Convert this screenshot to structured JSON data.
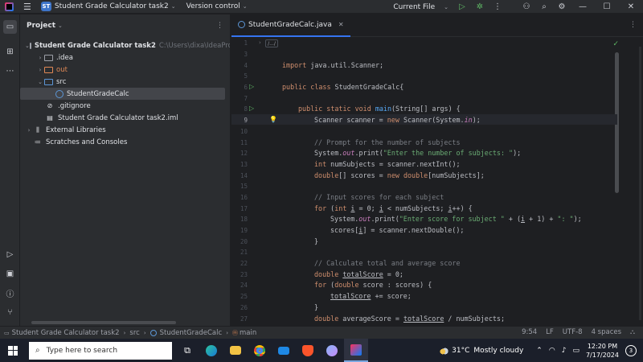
{
  "titlebar": {
    "project_badge": "ST",
    "project_name": "Student Grade Calculator task2",
    "version_control": "Version control",
    "run_config": "Current File"
  },
  "project_panel": {
    "title": "Project",
    "tree": [
      {
        "name": "Student Grade Calculator task2",
        "path": "C:\\Users\\dixa\\IdeaProjec"
      },
      {
        "name": ".idea"
      },
      {
        "name": "out"
      },
      {
        "name": "src"
      },
      {
        "name": "StudentGradeCalc"
      },
      {
        "name": ".gitignore"
      },
      {
        "name": "Student Grade Calculator task2.iml"
      },
      {
        "name": "External Libraries"
      },
      {
        "name": "Scratches and Consoles"
      }
    ]
  },
  "editor": {
    "tab_label": "StudentGradeCalc.java",
    "fold_marker": "/.../",
    "line_numbers": [
      "1",
      "3",
      "4",
      "5",
      "6",
      "7",
      "8",
      "9",
      "10",
      "11",
      "12",
      "13",
      "14",
      "15",
      "16",
      "17",
      "18",
      "19",
      "20",
      "21",
      "22",
      "23",
      "24",
      "25",
      "26",
      "27"
    ],
    "code": {
      "l4_kw": "import",
      "l4_rest": " java.util.Scanner;",
      "l6_kw": "public class",
      "l6_rest": " StudentGradeCalc{",
      "l8_kw": "public static void",
      "l8_fn": "main",
      "l8_rest": "(String[] args) {",
      "l9_a": "Scanner scanner = ",
      "l9_kw": "new",
      "l9_b": " Scanner(System.",
      "l9_fld": "in",
      "l9_c": ");",
      "l11": "// Prompt for the number of subjects",
      "l12_a": "System.",
      "l12_fld": "out",
      "l12_b": ".print(",
      "l12_str": "\"Enter the number of subjects: \"",
      "l12_c": ");",
      "l13_kw": "int",
      "l13_rest": " numSubjects = scanner.nextInt();",
      "l14_kw1": "double",
      "l14_a": "[] scores = ",
      "l14_kw2": "new double",
      "l14_b": "[numSubjects];",
      "l16": "// Input scores for each subject",
      "l17_kw": "for",
      "l17_a": " (",
      "l17_kw2": "int",
      "l17_b": " ",
      "l17_i": "i",
      "l17_c": " = 0; ",
      "l17_i2": "i",
      "l17_d": " < numSubjects; ",
      "l17_i3": "i",
      "l17_e": "++) {",
      "l18_a": "System.",
      "l18_fld": "out",
      "l18_b": ".print(",
      "l18_str1": "\"Enter score for subject \"",
      "l18_c": " + (",
      "l18_i": "i",
      "l18_d": " + 1) + ",
      "l18_str2": "\": \"",
      "l18_e": ");",
      "l19_a": "scores[",
      "l19_i": "i",
      "l19_b": "] = scanner.nextDouble();",
      "l20": "}",
      "l22": "// Calculate total and average score",
      "l23_kw": "double",
      "l23_a": " ",
      "l23_v": "totalScore",
      "l23_b": " = 0;",
      "l24_kw": "for",
      "l24_a": " (",
      "l24_kw2": "double",
      "l24_b": " score : scores) {",
      "l25_v": "totalScore",
      "l25_b": " += score;",
      "l26": "}",
      "l27_kw": "double",
      "l27_a": " averageScore = ",
      "l27_v": "totalScore",
      "l27_b": " / numSubjects;"
    }
  },
  "statusbar": {
    "breadcrumb": [
      "Student Grade Calculator task2",
      "src",
      "StudentGradeCalc",
      "main"
    ],
    "position": "9:54",
    "line_sep": "LF",
    "encoding": "UTF-8",
    "indent": "4 spaces"
  },
  "taskbar": {
    "search_placeholder": "Type here to search",
    "weather_temp": "31°C",
    "weather_desc": "Mostly cloudy",
    "time": "12:20 PM",
    "date": "7/17/2024",
    "notif_count": "3"
  },
  "colors": {
    "accent": "#3574f0",
    "keyword": "#cf8e6d",
    "string": "#6aab73",
    "comment": "#7a7e85",
    "function": "#56a8f5",
    "field": "#c77dbb"
  }
}
